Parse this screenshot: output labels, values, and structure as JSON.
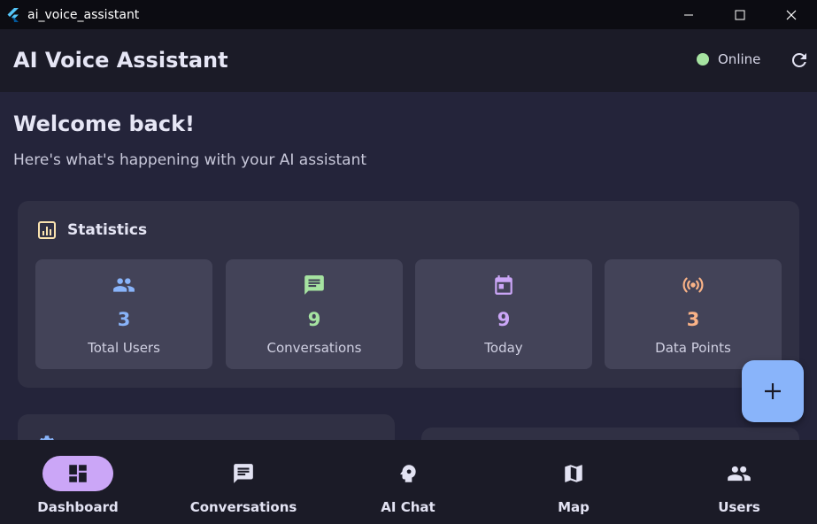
{
  "window": {
    "title": "ai_voice_assistant"
  },
  "appbar": {
    "title": "AI Voice Assistant",
    "status": "Online"
  },
  "welcome": {
    "heading": "Welcome back!",
    "subtitle": "Here's what's happening with your AI assistant"
  },
  "stats": {
    "title": "Statistics",
    "tiles": [
      {
        "icon": "people-icon",
        "value": "3",
        "label": "Total Users",
        "color": "#89b4fa"
      },
      {
        "icon": "chat-icon",
        "value": "9",
        "label": "Conversations",
        "color": "#a6e3a1"
      },
      {
        "icon": "calendar-icon",
        "value": "9",
        "label": "Today",
        "color": "#cba6f7"
      },
      {
        "icon": "broadcast-icon",
        "value": "3",
        "label": "Data Points",
        "color": "#fab387"
      }
    ]
  },
  "nav": {
    "items": [
      {
        "label": "Dashboard",
        "icon": "dashboard-icon",
        "active": true
      },
      {
        "label": "Conversations",
        "icon": "chat-icon",
        "active": false
      },
      {
        "label": "AI Chat",
        "icon": "brain-icon",
        "active": false
      },
      {
        "label": "Map",
        "icon": "map-icon",
        "active": false
      },
      {
        "label": "Users",
        "icon": "people-icon",
        "active": false
      }
    ]
  },
  "colors": {
    "accent": "#89b4fa",
    "online": "#a6e3a1",
    "active_nav": "#cba6f7"
  }
}
